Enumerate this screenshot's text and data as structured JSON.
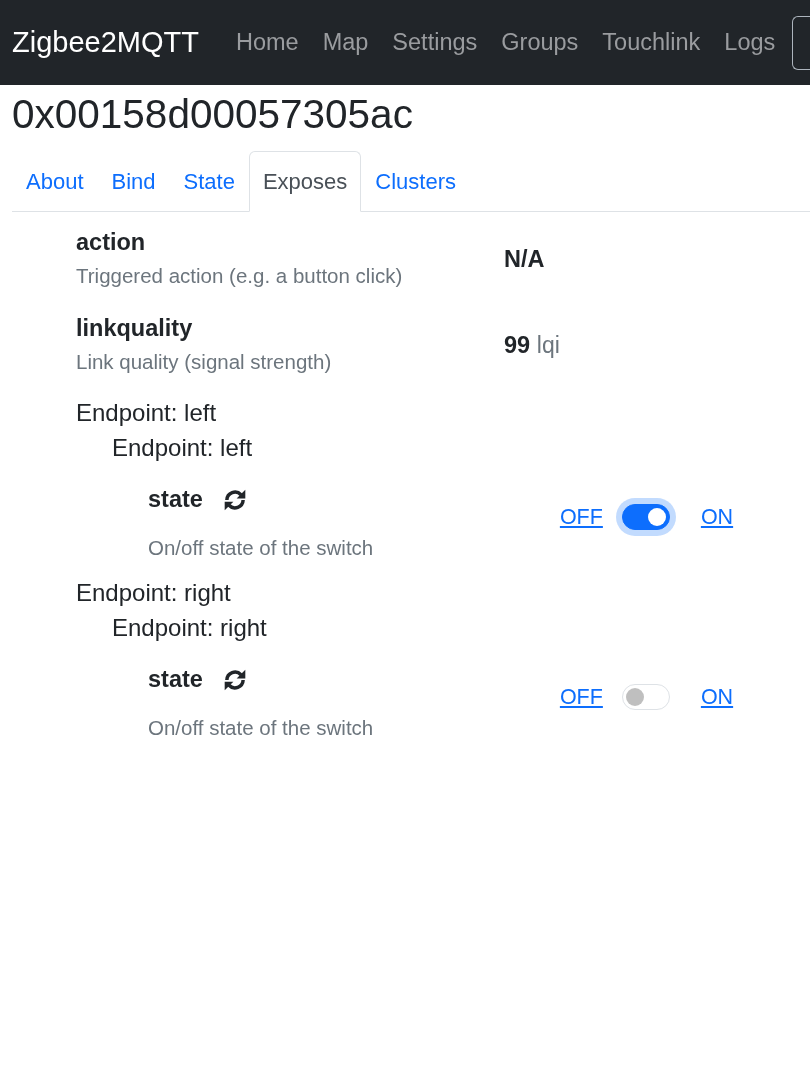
{
  "navbar": {
    "brand": "Zigbee2MQTT",
    "links": [
      {
        "label": "Home"
      },
      {
        "label": "Map"
      },
      {
        "label": "Settings"
      },
      {
        "label": "Groups"
      },
      {
        "label": "Touchlink"
      },
      {
        "label": "Logs"
      }
    ]
  },
  "device_title": "0x00158d00057305ac",
  "tabs": [
    {
      "label": "About",
      "selected": false
    },
    {
      "label": "Bind",
      "selected": false
    },
    {
      "label": "State",
      "selected": false
    },
    {
      "label": "Exposes",
      "selected": true
    },
    {
      "label": "Clusters",
      "selected": false
    }
  ],
  "exposes": [
    {
      "kind": "value",
      "name": "action",
      "description": "Triggered action (e.g. a button click)",
      "value": "N/A"
    },
    {
      "kind": "value",
      "name": "linkquality",
      "description": "Link quality (signal strength)",
      "value": "99",
      "unit": "lqi"
    },
    {
      "kind": "group",
      "label": "Endpoint: left",
      "children": [
        {
          "kind": "group",
          "label": "Endpoint: left",
          "children": [
            {
              "kind": "switch",
              "name": "state",
              "description": "On/off state of the switch",
              "off_label": "OFF",
              "on_label": "ON",
              "on": true,
              "focused": true
            }
          ]
        }
      ]
    },
    {
      "kind": "group",
      "label": "Endpoint: right",
      "children": [
        {
          "kind": "group",
          "label": "Endpoint: right",
          "children": [
            {
              "kind": "switch",
              "name": "state",
              "description": "On/off state of the switch",
              "off_label": "OFF",
              "on_label": "ON",
              "on": false,
              "focused": false
            }
          ]
        }
      ]
    }
  ]
}
